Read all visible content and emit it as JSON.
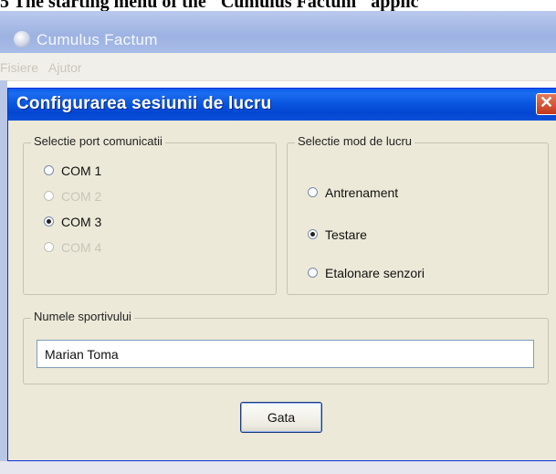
{
  "caption": "5 The starting menu of the \"Cumulus Factum\" applic",
  "app": {
    "title": "Cumulus Factum",
    "menu": [
      "Fisiere",
      "Ajutor"
    ]
  },
  "dialog": {
    "title": "Configurarea sesiunii de lucru",
    "close_icon": "close-icon",
    "port_group": {
      "label": "Selectie port comunicatii",
      "options": [
        {
          "label": "COM 1",
          "checked": false,
          "enabled": true
        },
        {
          "label": "COM 2",
          "checked": false,
          "enabled": false
        },
        {
          "label": "COM 3",
          "checked": true,
          "enabled": true
        },
        {
          "label": "COM 4",
          "checked": false,
          "enabled": false
        }
      ]
    },
    "mode_group": {
      "label": "Selectie mod de lucru",
      "options": [
        {
          "label": "Antrenament",
          "checked": false,
          "enabled": true
        },
        {
          "label": "Testare",
          "checked": true,
          "enabled": true
        },
        {
          "label": "Etalonare senzori",
          "checked": false,
          "enabled": true
        }
      ]
    },
    "name_group": {
      "label": "Numele sportivului",
      "value": "Marian Toma"
    },
    "ok_button": "Gata"
  },
  "colors": {
    "titlebar": "#0346d2",
    "dialog_bg": "#ece9d8",
    "close": "#c4371b"
  }
}
